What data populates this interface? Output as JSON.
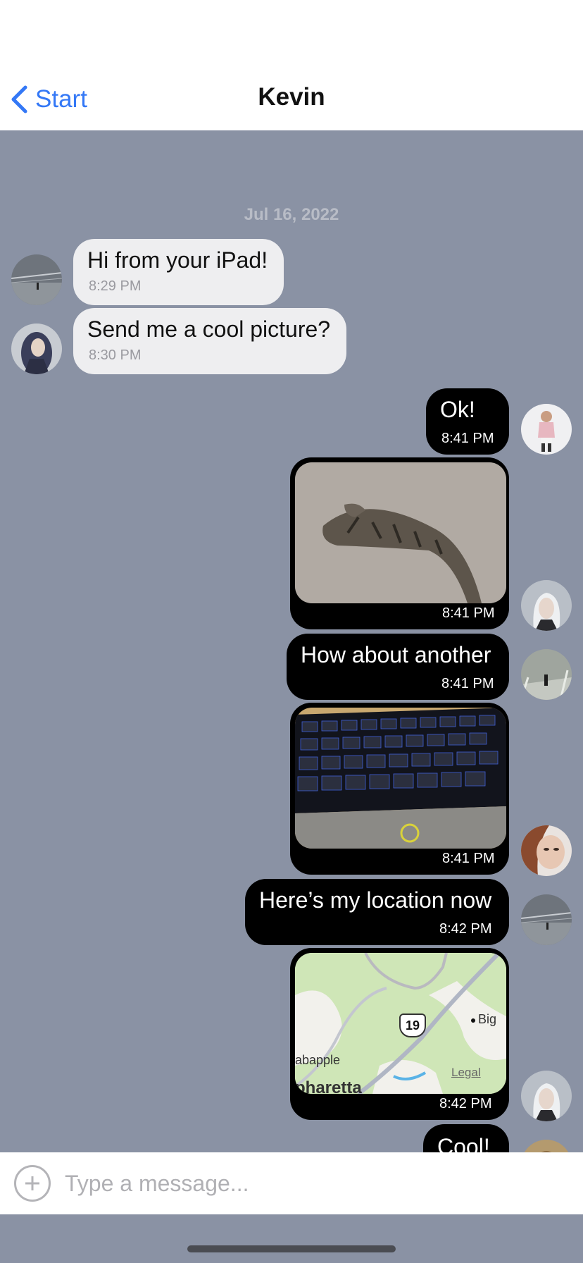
{
  "nav": {
    "back_label": "Start",
    "title": "Kevin"
  },
  "chat": {
    "date_separator": "Jul 16, 2022",
    "messages": [
      {
        "direction": "incoming",
        "type": "text",
        "text": "Hi from your iPad!",
        "time": "8:29 PM"
      },
      {
        "direction": "incoming",
        "type": "text",
        "text": "Send me a cool picture?",
        "time": "8:30 PM"
      },
      {
        "direction": "outgoing",
        "type": "text",
        "text": "Ok!",
        "time": "8:41 PM"
      },
      {
        "direction": "outgoing",
        "type": "image",
        "content": "cat-photo",
        "time": "8:41 PM"
      },
      {
        "direction": "outgoing",
        "type": "text",
        "text": "How about another",
        "time": "8:41 PM"
      },
      {
        "direction": "outgoing",
        "type": "image",
        "content": "keyboard-photo",
        "time": "8:41 PM"
      },
      {
        "direction": "outgoing",
        "type": "text",
        "text": "Here’s my location now",
        "time": "8:42 PM"
      },
      {
        "direction": "outgoing",
        "type": "location",
        "content": "map-snapshot",
        "time": "8:42 PM"
      },
      {
        "direction": "outgoing",
        "type": "text",
        "text": "Cool!"
      }
    ],
    "map": {
      "route_shield": "19",
      "places": [
        "Big",
        "abapple",
        "pharetta"
      ],
      "legal_label": "Legal"
    }
  },
  "composer": {
    "placeholder": "Type a message..."
  },
  "colors": {
    "accent": "#3478f6",
    "chat_background": "#8a92a4",
    "incoming_bubble": "#eeeef0",
    "outgoing_bubble": "#000000"
  }
}
